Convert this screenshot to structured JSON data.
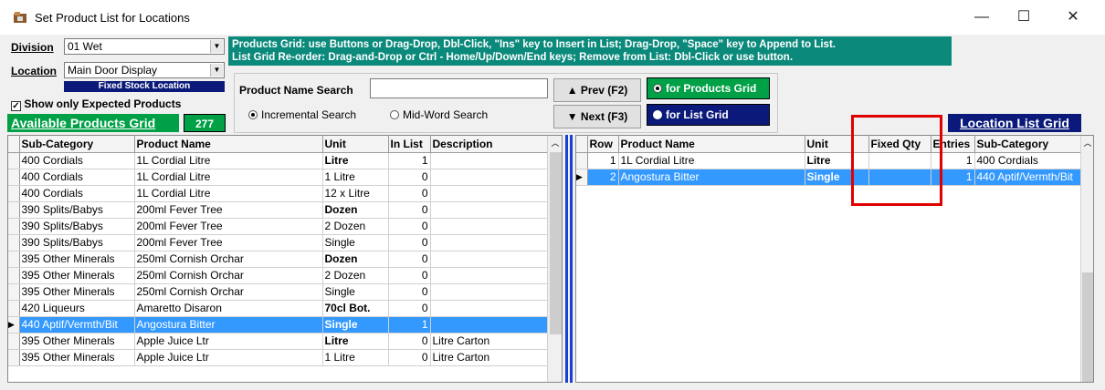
{
  "window": {
    "title": "Set Product List for Locations",
    "minimize": "—",
    "maximize": "☐",
    "close": "✕"
  },
  "filters": {
    "division_label": "Division",
    "division_value": "01 Wet",
    "location_label": "Location",
    "location_value": "Main Door Display",
    "fixed_stock_badge": "Fixed Stock Location",
    "show_expected_label": "Show only Expected Products",
    "show_expected_checked": true
  },
  "help_text": {
    "line1": "Products Grid: use Buttons or Drag-Drop, Dbl-Click, \"Ins\" key to Insert in List; Drag-Drop, \"Space\" key to Append to List.",
    "line2": "List Grid Re-order: Drag-and-Drop or Ctrl - Home/Up/Down/End keys; Remove from List: Dbl-Click or use button."
  },
  "available_grid_label": "Available Products Grid",
  "available_count": "277",
  "search": {
    "label": "Product Name Search",
    "value": "",
    "incremental_label": "Incremental Search",
    "midword_label": "Mid-Word Search",
    "selected_mode": "incremental",
    "prev_button": "▲ Prev (F2)",
    "next_button": "▼ Next (F3)",
    "for_products_label": "for Products Grid",
    "for_list_label": "for List Grid",
    "target": "products"
  },
  "location_grid_label": "Location List Grid",
  "products_grid": {
    "columns": [
      "Sub-Category",
      "Product Name",
      "Unit",
      "In List",
      "Description"
    ],
    "rows": [
      {
        "sub": "400 Cordials",
        "name": "1L Cordial Litre",
        "unit": "Litre",
        "unit_bold": true,
        "inlist": "1",
        "desc": ""
      },
      {
        "sub": "400 Cordials",
        "name": "1L Cordial Litre",
        "unit": "1 Litre",
        "unit_bold": false,
        "inlist": "0",
        "desc": ""
      },
      {
        "sub": "400 Cordials",
        "name": "1L Cordial Litre",
        "unit": "12 x Litre",
        "unit_bold": false,
        "inlist": "0",
        "desc": ""
      },
      {
        "sub": "390 Splits/Babys",
        "name": "200ml Fever Tree",
        "unit": "Dozen",
        "unit_bold": true,
        "inlist": "0",
        "desc": ""
      },
      {
        "sub": "390 Splits/Babys",
        "name": "200ml Fever Tree",
        "unit": "2 Dozen",
        "unit_bold": false,
        "inlist": "0",
        "desc": ""
      },
      {
        "sub": "390 Splits/Babys",
        "name": "200ml Fever Tree",
        "unit": "Single",
        "unit_bold": false,
        "inlist": "0",
        "desc": ""
      },
      {
        "sub": "395 Other Minerals",
        "name": "250ml Cornish Orchar",
        "unit": "Dozen",
        "unit_bold": true,
        "inlist": "0",
        "desc": ""
      },
      {
        "sub": "395 Other Minerals",
        "name": "250ml Cornish Orchar",
        "unit": "2 Dozen",
        "unit_bold": false,
        "inlist": "0",
        "desc": ""
      },
      {
        "sub": "395 Other Minerals",
        "name": "250ml Cornish Orchar",
        "unit": "Single",
        "unit_bold": false,
        "inlist": "0",
        "desc": ""
      },
      {
        "sub": "420 Liqueurs",
        "name": "Amaretto Disaron",
        "unit": "70cl Bot.",
        "unit_bold": true,
        "inlist": "0",
        "desc": ""
      },
      {
        "sub": "440 Aptif/Vermth/Bit",
        "name": "Angostura Bitter",
        "unit": "Single",
        "unit_bold": true,
        "inlist": "1",
        "desc": "",
        "selected": true
      },
      {
        "sub": "395 Other Minerals",
        "name": "Apple Juice Ltr",
        "unit": "Litre",
        "unit_bold": true,
        "inlist": "0",
        "desc": "Litre Carton"
      },
      {
        "sub": "395 Other Minerals",
        "name": "Apple Juice Ltr",
        "unit": "1 Litre",
        "unit_bold": false,
        "inlist": "0",
        "desc": "Litre Carton"
      }
    ]
  },
  "list_grid": {
    "columns": [
      "Row",
      "Product Name",
      "Unit",
      "Fixed Qty",
      "Entries",
      "Sub-Category"
    ],
    "rows": [
      {
        "row": "1",
        "name": "1L Cordial Litre",
        "unit": "Litre",
        "fixed": "",
        "entries": "1",
        "sub": "400 Cordials"
      },
      {
        "row": "2",
        "name": "Angostura Bitter",
        "unit": "Single",
        "fixed": "",
        "entries": "1",
        "sub": "440 Aptif/Vermth/Bit",
        "selected": true
      }
    ]
  },
  "colors": {
    "teal": "#0b8a7c",
    "green": "#00a046",
    "navy": "#0b1a7a",
    "selection": "#3399ff",
    "highlight_box": "#e00000"
  }
}
